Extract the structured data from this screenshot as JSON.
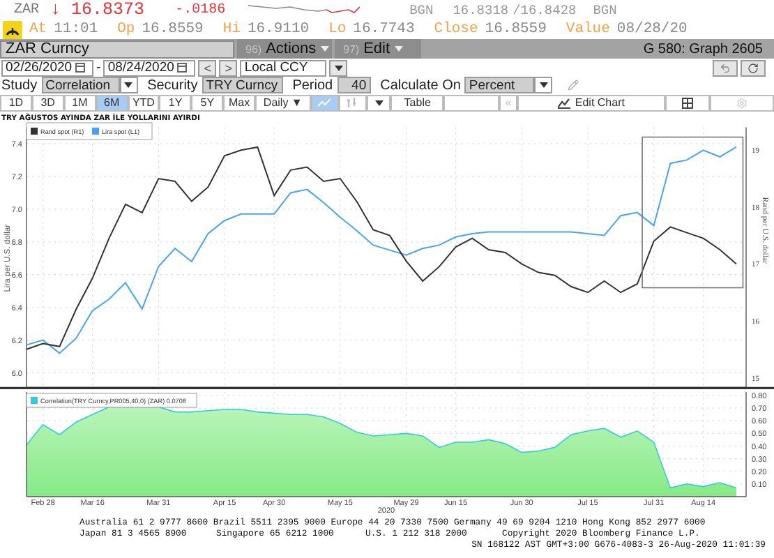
{
  "quote": {
    "ticker": "ZAR",
    "arrow": "↓",
    "last": "16.8373",
    "change": "-.0186",
    "bid_source": "BGN",
    "bid": "16.8318",
    "ask": "/16.8428",
    "ask_source": "BGN"
  },
  "stats": [
    {
      "label": "At",
      "value": "11:01"
    },
    {
      "label": "Op",
      "value": "16.8559"
    },
    {
      "label": "Hi",
      "value": "16.9110"
    },
    {
      "label": "Lo",
      "value": "16.7743"
    },
    {
      "label": "Close",
      "value": "16.8559"
    },
    {
      "label": "Value",
      "value": "08/28/20"
    }
  ],
  "command_bar": {
    "security": "ZAR Curncy",
    "menus": [
      {
        "number": "96)",
        "label": "Actions"
      },
      {
        "number": "97)",
        "label": "Edit"
      }
    ],
    "page_title": "G 580: Graph 2605"
  },
  "date_range": {
    "start": "02/26/2020",
    "separator": "-",
    "end": "08/24/2020",
    "prev": "<",
    "next": ">",
    "currency": "Local CCY"
  },
  "study_row": [
    {
      "kind": "label",
      "text": "Study"
    },
    {
      "kind": "select",
      "text": "Correlation"
    },
    {
      "kind": "label",
      "text": "Security"
    },
    {
      "kind": "field",
      "text": "TRY Curncy"
    },
    {
      "kind": "label",
      "text": "Period"
    },
    {
      "kind": "number",
      "text": "40"
    },
    {
      "kind": "label",
      "text": "Calculate On"
    },
    {
      "kind": "select",
      "text": "Percent"
    }
  ],
  "periods": [
    {
      "label": "1D",
      "selected": false
    },
    {
      "label": "3D",
      "selected": false
    },
    {
      "label": "1M",
      "selected": false
    },
    {
      "label": "6M",
      "selected": true
    },
    {
      "label": "YTD",
      "selected": false
    },
    {
      "label": "1Y",
      "selected": false
    },
    {
      "label": "5Y",
      "selected": false
    },
    {
      "label": "Max",
      "selected": false
    }
  ],
  "frequency": "Daily ▼",
  "chart_types": [
    {
      "kind": "line",
      "selected": true
    },
    {
      "kind": "bar",
      "selected": false
    }
  ],
  "toolbar": {
    "table": "Table",
    "collapse": "«",
    "edit_chart": "Edit Chart"
  },
  "price_chart": {
    "chart_data": {
      "type": "line",
      "title": "TRY AĞUSTOS AYINDA ZAR İLE YOLLARINI AYIRDI",
      "ylabel": "Lira per U.S. dollar",
      "grid": true,
      "categories": [
        null,
        null,
        null,
        null,
        null,
        null,
        null,
        null,
        null,
        null,
        null,
        null,
        null,
        null,
        null,
        null,
        null,
        null,
        null,
        null,
        null,
        null,
        null,
        null,
        null,
        null,
        null,
        null,
        null,
        null,
        null,
        null,
        null,
        null,
        null,
        null,
        null,
        null,
        null,
        null,
        null,
        null,
        null,
        null
      ],
      "ylim": [
        5.9,
        7.5
      ],
      "yticks": [
        {
          "value": 6.0,
          "label": "6.0"
        },
        {
          "value": 6.2,
          "label": "6.2"
        },
        {
          "value": 6.4,
          "label": "6.4"
        },
        {
          "value": 6.6,
          "label": "6.6"
        },
        {
          "value": 6.8,
          "label": "6.8"
        },
        {
          "value": 7.0,
          "label": "7.0"
        },
        {
          "value": 7.2,
          "label": "7.2"
        },
        {
          "value": 7.4,
          "label": "7.4"
        }
      ],
      "series": [
        {
          "name": "Lira spot (L1)",
          "color": "#4aa3f0",
          "values": [
            6.17,
            6.2,
            6.12,
            6.21,
            6.38,
            6.45,
            6.55,
            6.39,
            6.65,
            6.76,
            6.68,
            6.85,
            6.93,
            6.97,
            6.97,
            6.97,
            7.1,
            7.12,
            7.04,
            6.95,
            6.87,
            6.78,
            6.75,
            6.72,
            6.76,
            6.78,
            6.83,
            6.85,
            6.86,
            6.86,
            6.86,
            6.86,
            6.86,
            6.86,
            6.85,
            6.84,
            6.96,
            6.98,
            6.9,
            7.28,
            7.3,
            7.36,
            7.32,
            7.38
          ]
        }
      ]
    }
  },
  "rand_chart": {
    "chart_data": {
      "type": "line",
      "ylabel": "Rand per U.S. dollar",
      "categories": [
        null,
        null,
        null,
        null,
        null,
        null,
        null,
        null,
        null,
        null,
        null,
        null,
        null,
        null,
        null,
        null,
        null,
        null,
        null,
        null,
        null,
        null,
        null,
        null,
        null,
        null,
        null,
        null,
        null,
        null,
        null,
        null,
        null,
        null,
        null,
        null,
        null,
        null,
        null,
        null,
        null,
        null,
        null,
        null
      ],
      "ylim": [
        14.8,
        19.4
      ],
      "yticks": [
        15,
        16,
        17,
        18,
        19
      ],
      "series": [
        {
          "name": "Rand spot (R1)",
          "color": "#333333",
          "values": [
            15.5,
            15.6,
            15.55,
            16.2,
            16.75,
            17.45,
            18.05,
            17.9,
            18.5,
            18.45,
            18.1,
            18.35,
            18.9,
            19.0,
            19.05,
            18.2,
            18.65,
            18.7,
            18.45,
            18.5,
            18.1,
            17.6,
            17.5,
            17.05,
            16.7,
            16.95,
            17.3,
            17.45,
            17.25,
            17.2,
            17.0,
            16.85,
            16.8,
            16.6,
            16.5,
            16.7,
            16.5,
            16.65,
            17.4,
            17.65,
            17.55,
            17.45,
            17.25,
            17.0
          ]
        }
      ]
    }
  },
  "correlation_chart": {
    "legend_value": "0.0708",
    "chart_data": {
      "type": "area",
      "xlabel": "2020",
      "grid": true,
      "categories": [
        null,
        "Feb 28",
        null,
        null,
        "Mar 16",
        null,
        null,
        null,
        "Mar 31",
        null,
        null,
        null,
        "Apr 15",
        null,
        null,
        "Apr 30",
        null,
        null,
        null,
        "May 15",
        null,
        null,
        null,
        "May 29",
        null,
        null,
        "Jun 15",
        null,
        null,
        null,
        "Jun 30",
        null,
        null,
        null,
        "Jul 15",
        null,
        null,
        null,
        "Jul 31",
        null,
        null,
        "Aug 14",
        null,
        null
      ],
      "ylim": [
        0,
        0.85
      ],
      "yticks": [
        {
          "value": 0.1,
          "label": "0.10"
        },
        {
          "value": 0.2,
          "label": "0.20"
        },
        {
          "value": 0.3,
          "label": "0.30"
        },
        {
          "value": 0.4,
          "label": "0.40"
        },
        {
          "value": 0.5,
          "label": "0.50"
        },
        {
          "value": 0.6,
          "label": "0.60"
        },
        {
          "value": 0.7,
          "label": "0.70"
        },
        {
          "value": 0.8,
          "label": "0.80"
        }
      ],
      "series": [
        {
          "name": "Correlation(TRY Curncy,PR005,40,0) (ZAR)",
          "color": "#33ccdd",
          "values": [
            0.41,
            0.57,
            0.49,
            0.59,
            0.65,
            0.71,
            0.71,
            0.71,
            0.71,
            0.67,
            0.67,
            0.68,
            0.69,
            0.69,
            0.67,
            0.66,
            0.65,
            0.65,
            0.63,
            0.58,
            0.51,
            0.48,
            0.49,
            0.5,
            0.48,
            0.39,
            0.43,
            0.43,
            0.45,
            0.42,
            0.35,
            0.36,
            0.39,
            0.49,
            0.52,
            0.54,
            0.47,
            0.52,
            0.43,
            0.07,
            0.1,
            0.08,
            0.11,
            0.07
          ]
        }
      ]
    }
  },
  "footer": {
    "lines": [
      [
        "Australia 61 2 9777 8600 Brazil 5511 2395 9000 Europe 44 20 7330 7500 Germany 49 69 9204 1210 Hong Kong 852 2977 6000"
      ],
      [
        "Japan 81 3 4565 8900",
        "Singapore 65 6212 1000",
        "U.S. 1 212 318 2000",
        "Copyright 2020 Bloomberg Finance L.P."
      ],
      [
        "SN 168122 AST GMT+3:00 G676-4083-3 26-Aug-2020 11:01:39"
      ]
    ]
  }
}
